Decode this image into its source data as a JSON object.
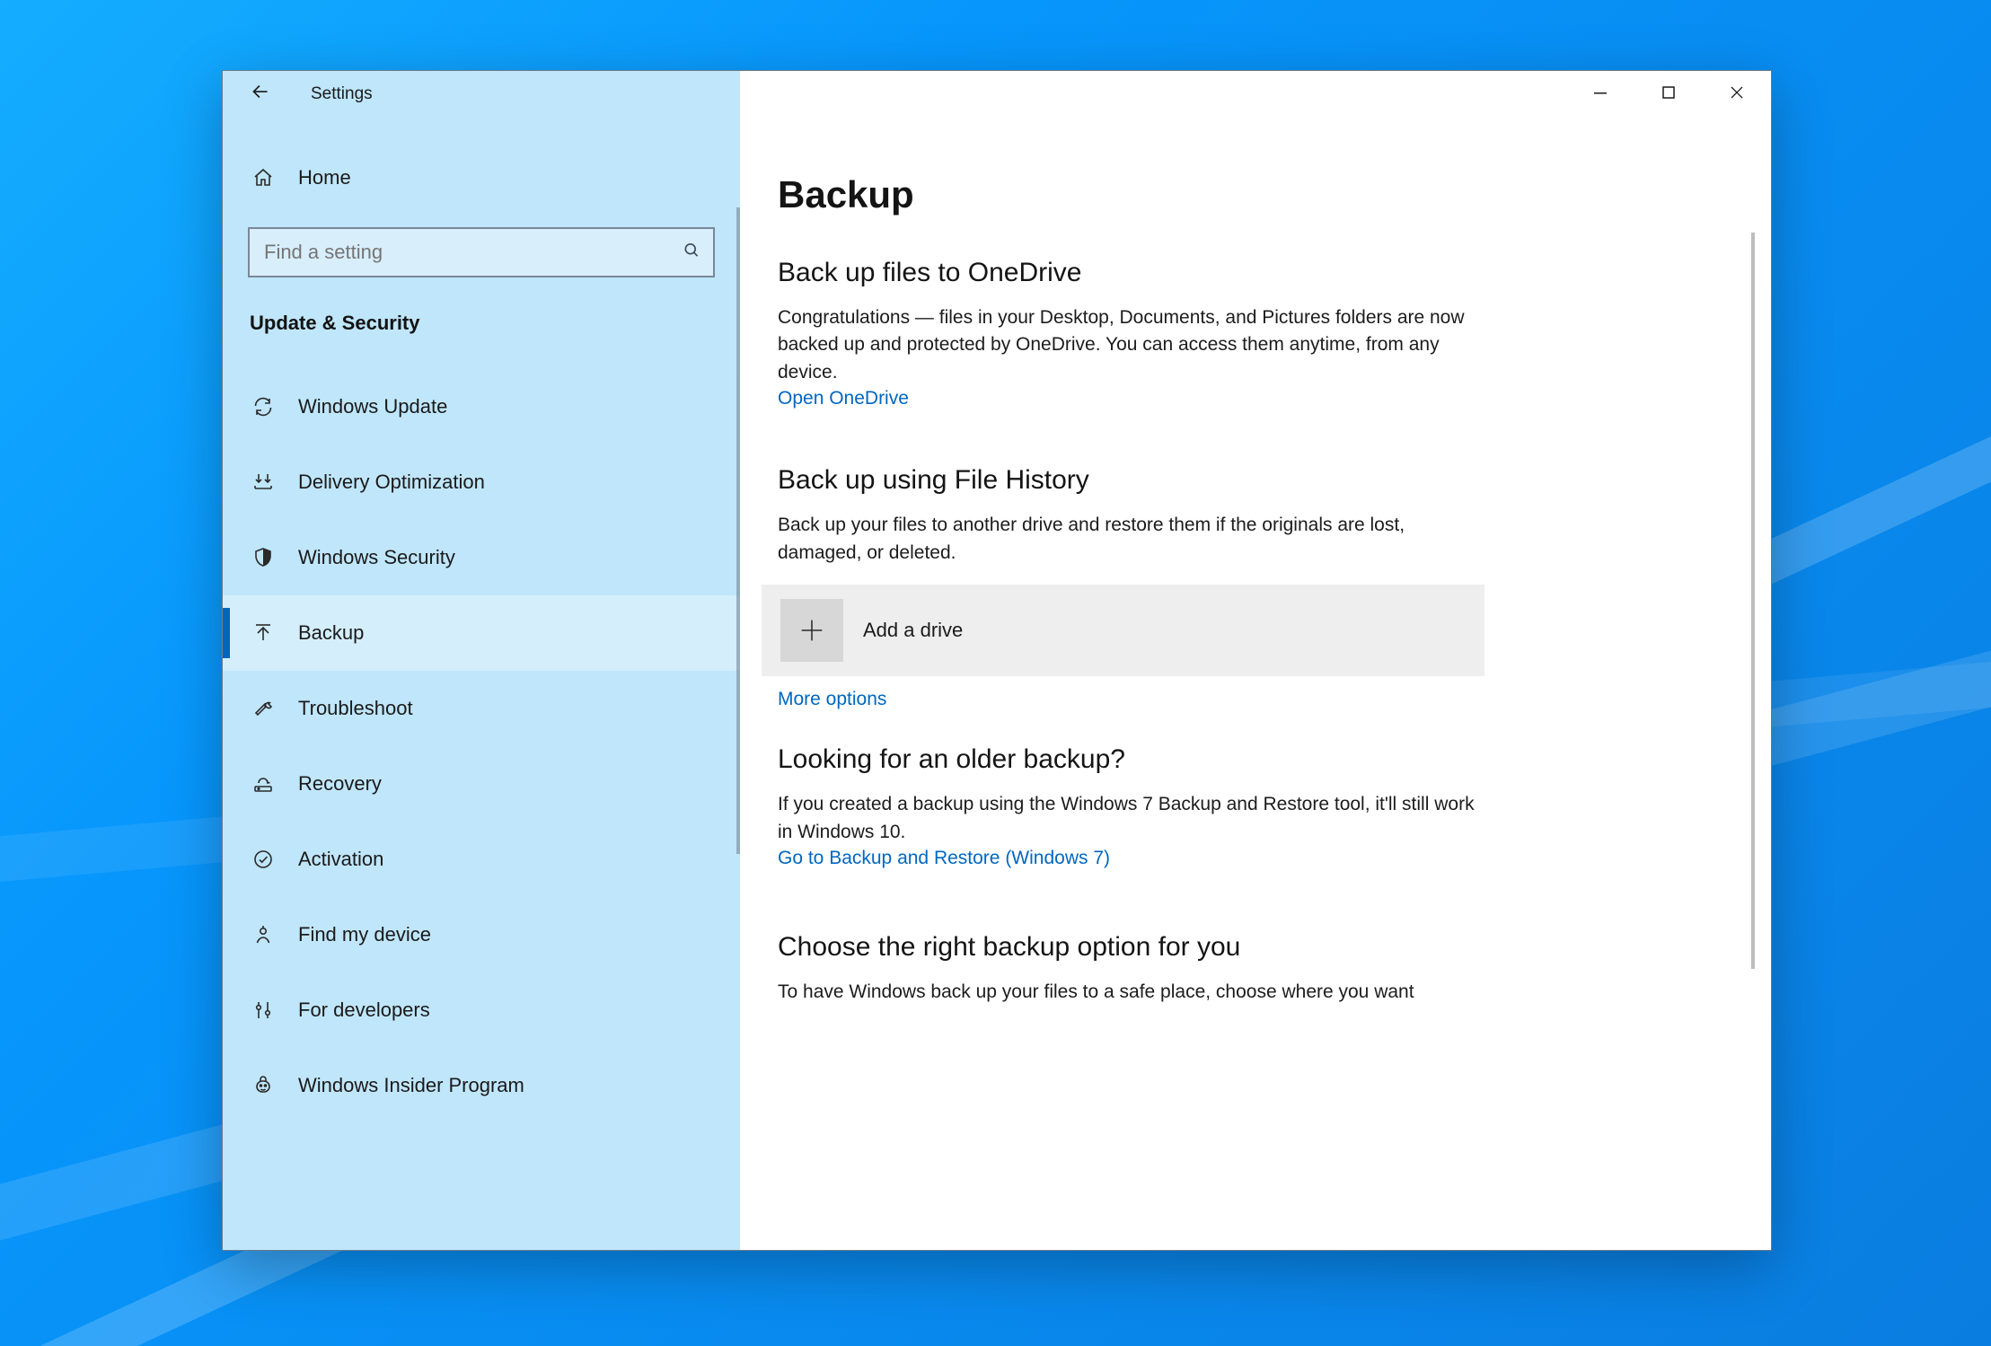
{
  "window": {
    "title": "Settings"
  },
  "sidebar": {
    "home_label": "Home",
    "search_placeholder": "Find a setting",
    "category_label": "Update & Security",
    "items": [
      {
        "label": "Windows Update",
        "icon": "refresh"
      },
      {
        "label": "Delivery Optimization",
        "icon": "download-arrows"
      },
      {
        "label": "Windows Security",
        "icon": "shield"
      },
      {
        "label": "Backup",
        "icon": "arrow-up-line",
        "selected": true
      },
      {
        "label": "Troubleshoot",
        "icon": "wrench"
      },
      {
        "label": "Recovery",
        "icon": "clock-arrow"
      },
      {
        "label": "Activation",
        "icon": "check-circle"
      },
      {
        "label": "Find my device",
        "icon": "person-pin"
      },
      {
        "label": "For developers",
        "icon": "sliders"
      },
      {
        "label": "Windows Insider Program",
        "icon": "bug-face"
      }
    ]
  },
  "main": {
    "page_title": "Backup",
    "onedrive": {
      "title": "Back up files to OneDrive",
      "body": "Congratulations — files in your Desktop, Documents, and Pictures folders are now backed up and protected by OneDrive. You can access them anytime, from any device.",
      "link": "Open OneDrive"
    },
    "file_history": {
      "title": "Back up using File History",
      "body": "Back up your files to another drive and restore them if the originals are lost, damaged, or deleted.",
      "add_drive_label": "Add a drive",
      "more_options": "More options"
    },
    "older": {
      "title": "Looking for an older backup?",
      "body": "If you created a backup using the Windows 7 Backup and Restore tool, it'll still work in Windows 10.",
      "link": "Go to Backup and Restore (Windows 7)"
    },
    "choose": {
      "title": "Choose the right backup option for you",
      "body": "To have Windows back up your files to a safe place, choose where you want"
    }
  }
}
